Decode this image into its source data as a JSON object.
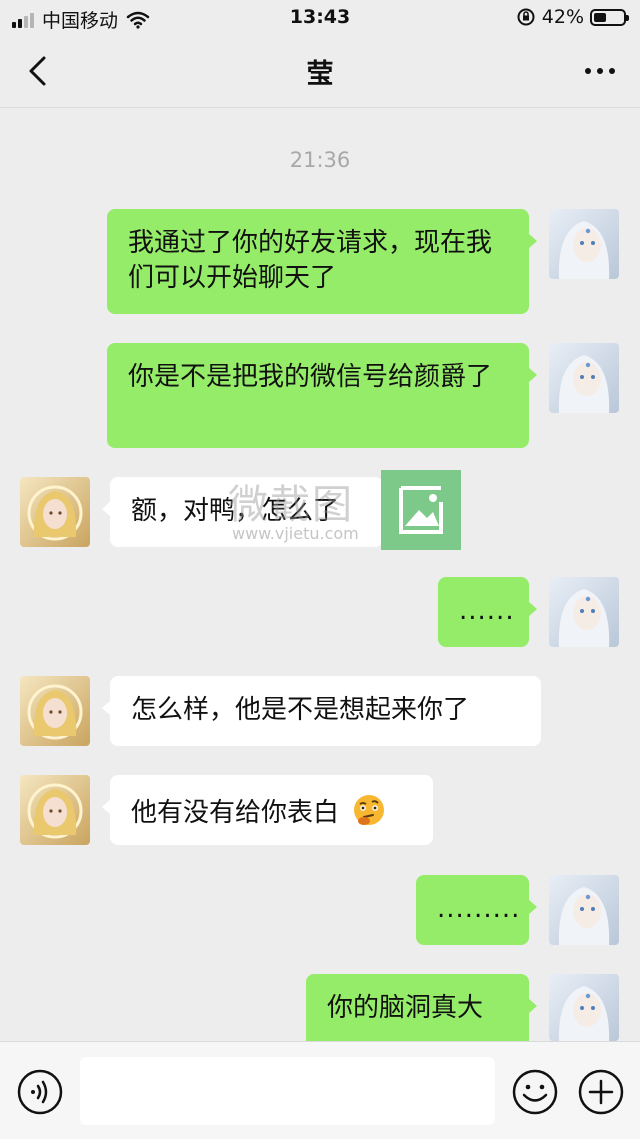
{
  "status_bar": {
    "carrier": "中国移动",
    "time": "13:43",
    "battery_percent": "42%",
    "battery_level": 0.42
  },
  "nav": {
    "title": "莹"
  },
  "chat": {
    "timestamp": "21:36",
    "messages": [
      {
        "side": "me",
        "text": "我通过了你的好友请求，现在我们可以开始聊天了"
      },
      {
        "side": "me",
        "text": "你是不是把我的微信号给颜爵了"
      },
      {
        "side": "them",
        "text": "额，对鸭，怎么了"
      },
      {
        "side": "me",
        "text": "......"
      },
      {
        "side": "them",
        "text": "怎么样，他是不是想起来你了"
      },
      {
        "side": "them",
        "text": "他有没有给你表白",
        "emoji": "thinking-face"
      },
      {
        "side": "me",
        "text": "........."
      },
      {
        "side": "me",
        "text": "你的脑洞真大"
      }
    ]
  },
  "watermark": {
    "text": "微截图",
    "url": "www.vjietu.com"
  },
  "colors": {
    "my_bubble": "#95ec69",
    "their_bubble": "#ffffff",
    "background": "#ededed"
  }
}
